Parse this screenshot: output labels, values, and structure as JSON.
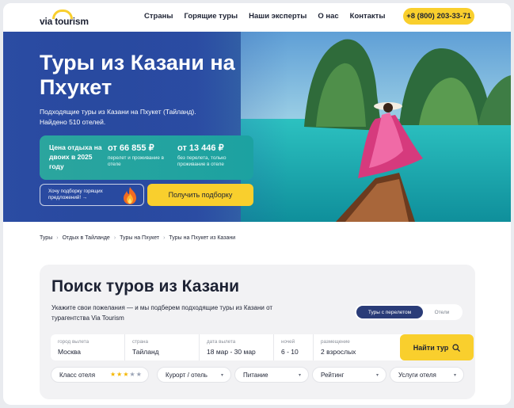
{
  "header": {
    "logo_text": "via tourism",
    "nav": [
      "Страны",
      "Горящие туры",
      "Наши эксперты",
      "О нас",
      "Контакты"
    ],
    "phone": "+8 (800) 203-33-71"
  },
  "hero": {
    "title": "Туры из Казани на Пхукет",
    "subtitle": "Подходящие туры из Казани на Пхукет (Тайланд). Найдено 510 отелей.",
    "price_label": "Цена отдыха на двоих в 2025 году",
    "price_1": "от 66 855 ₽",
    "price_1_note": "перелет и проживание в отеле",
    "price_2": "от 13 446 ₽",
    "price_2_note": "без перелета, только проживание в отеле",
    "hot_text": "Хочу подборку горящих предложений! →",
    "cta_label": "Получить подборку"
  },
  "breadcrumb": [
    "Туры",
    "Отдых в Тайланде",
    "Туры на Пхукет",
    "Туры на Пхукет из Казани"
  ],
  "search": {
    "title": "Поиск туров из Казани",
    "description": "Укажите свои пожелания — и мы подберем подходящие туры из Казани от турагентства Via Tourism",
    "toggle_active": "Туры с перелетом",
    "toggle_other": "Отели",
    "fields": [
      {
        "label": "город вылета",
        "value": "Москва"
      },
      {
        "label": "страна",
        "value": "Тайланд"
      },
      {
        "label": "дата вылета",
        "value": "18 мар - 30 мар"
      },
      {
        "label": "ночей",
        "value": "6 - 10"
      },
      {
        "label": "размещение",
        "value": "2 взрослых"
      }
    ],
    "find_label": "Найти тур",
    "filters": [
      "Класс отеля",
      "Курорт / отель",
      "Питание",
      "Рейтинг",
      "Услуги отеля"
    ],
    "hotel_stars": 3,
    "hotel_stars_max": 5
  },
  "colors": {
    "accent_yellow": "#f9cf2d",
    "hero_blue": "#1f3f93",
    "hero_teal": "#1ca2a1",
    "toggle_active": "#2a3c78"
  }
}
